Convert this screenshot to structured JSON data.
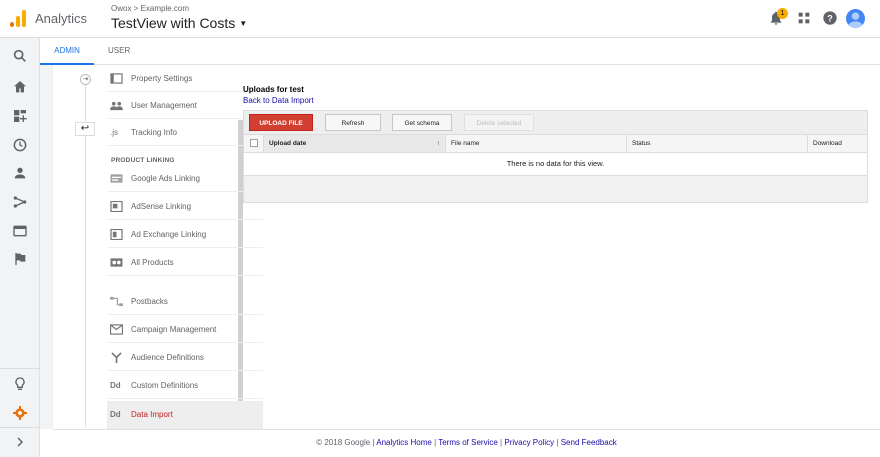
{
  "header": {
    "app_name": "Analytics",
    "breadcrumb": "Owox > Example.com",
    "view_title": "TestView with Costs",
    "notification_count": "1"
  },
  "tabs": [
    {
      "label": "ADMIN",
      "active": true
    },
    {
      "label": "USER",
      "active": false
    }
  ],
  "nav": {
    "items": [
      {
        "label": "Property Settings",
        "icon": "property-settings-icon"
      },
      {
        "label": "User Management",
        "icon": "users-icon"
      },
      {
        "label": "Tracking Info",
        "icon": "js-icon",
        "icon_text": ".js"
      }
    ],
    "section_label": "PRODUCT LINKING",
    "linking_items": [
      {
        "label": "Google Ads Linking",
        "icon": "google-ads-icon"
      },
      {
        "label": "AdSense Linking",
        "icon": "adsense-icon"
      },
      {
        "label": "Ad Exchange Linking",
        "icon": "ad-exchange-icon"
      },
      {
        "label": "All Products",
        "icon": "all-products-icon"
      }
    ],
    "other_items": [
      {
        "label": "Postbacks",
        "icon": "postbacks-icon"
      },
      {
        "label": "Campaign Management",
        "icon": "campaign-icon"
      },
      {
        "label": "Audience Definitions",
        "icon": "audience-icon"
      },
      {
        "label": "Custom Definitions",
        "icon": "custom-definitions-icon",
        "icon_text": "Dd"
      },
      {
        "label": "Data Import",
        "icon": "data-import-icon",
        "icon_text": "Dd",
        "active": true
      }
    ]
  },
  "content": {
    "title": "Uploads for test",
    "back_link": "Back to Data Import",
    "buttons": {
      "upload": "UPLOAD FILE",
      "refresh": "Refresh",
      "schema": "Get schema",
      "delete": "Delete selected"
    },
    "columns": {
      "upload_date": "Upload date",
      "sort_indicator": "↑",
      "file_name": "File name",
      "status": "Status",
      "download": "Download"
    },
    "empty_message": "There is no data for this view."
  },
  "footer": {
    "copyright": "© 2018 Google",
    "links": [
      "Analytics Home",
      "Terms of Service",
      "Privacy Policy",
      "Send Feedback"
    ]
  },
  "colors": {
    "accent": "#1a73e8",
    "primary_button": "#d23f31",
    "active_nav": "#c5221f",
    "logo_orange": "#f9ab00",
    "logo_dark_orange": "#e37400"
  },
  "rail_icons": [
    "search-icon",
    "home-icon",
    "customization-icon",
    "realtime-clock-icon",
    "audience-person-icon",
    "acquisition-icon",
    "behavior-icon",
    "conversions-flag-icon",
    "discover-lightbulb-icon",
    "admin-gear-icon",
    "expand-chevron-icon"
  ]
}
